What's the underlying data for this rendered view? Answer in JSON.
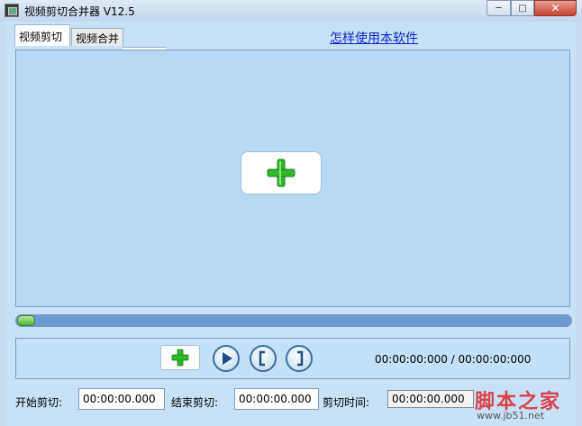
{
  "window": {
    "title": "视频剪切合并器 V12.5",
    "minimize_glyph": "─",
    "maximize_glyph": "□",
    "close_glyph": "✕"
  },
  "tabs": [
    {
      "label": "视频剪切",
      "active": true
    },
    {
      "label": "视频合并",
      "active": false
    }
  ],
  "help_link": "怎样使用本软件",
  "player": {
    "progress_fraction": 0.0,
    "time_display": "00:00:00:000 / 00:00:00:000"
  },
  "icons": {
    "add_video": "plus-icon",
    "add": "plus-icon",
    "play": "play-icon",
    "mark_in": "bracket-left-icon",
    "mark_out": "bracket-right-icon"
  },
  "cut": {
    "start_label": "开始剪切:",
    "start_value": "00:00:00.000",
    "end_label": "结束剪切:",
    "end_value": "00:00:00.000",
    "duration_label": "剪切时间:",
    "duration_value": "00:00:00.000"
  },
  "watermark": {
    "brand": "脚本之家",
    "url": "www.jb51.net"
  },
  "colors": {
    "accent_green": "#2fb82a",
    "link_blue": "#0a27c9",
    "progress_blue": "#6f9ad1"
  }
}
